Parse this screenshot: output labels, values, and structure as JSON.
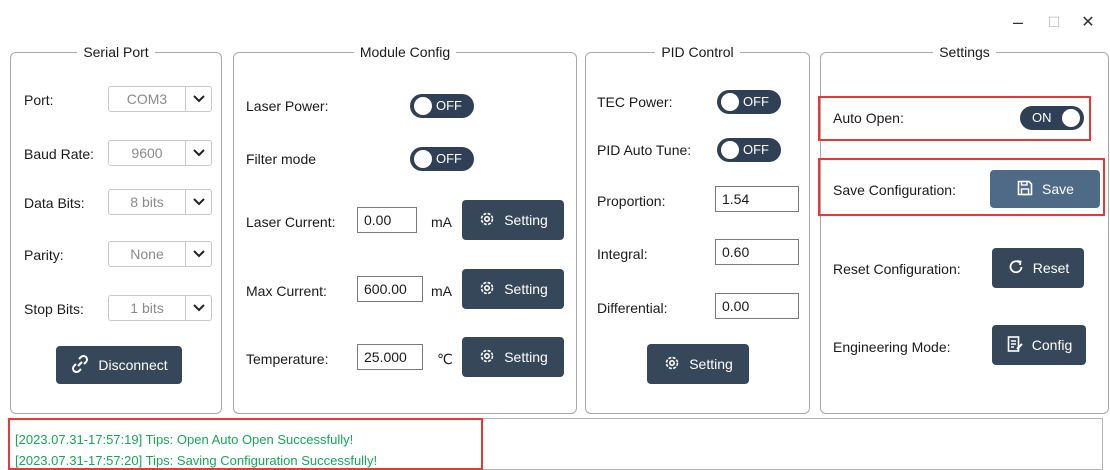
{
  "window": {
    "minimize_glyph": "–",
    "maximize_glyph": "☐",
    "close_glyph": "✕"
  },
  "serial_port": {
    "title": "Serial Port",
    "port_label": "Port:",
    "port_value": "COM3",
    "baud_label": "Baud Rate:",
    "baud_value": "9600",
    "databits_label": "Data Bits:",
    "databits_value": "8 bits",
    "parity_label": "Parity:",
    "parity_value": "None",
    "stopbits_label": "Stop Bits:",
    "stopbits_value": "1 bits",
    "disconnect_label": "Disconnect"
  },
  "module_config": {
    "title": "Module Config",
    "laser_power_label": "Laser Power:",
    "laser_power_state": "OFF",
    "filter_mode_label": "Filter mode",
    "filter_mode_state": "OFF",
    "laser_current_label": "Laser Current:",
    "laser_current_value": "0.00",
    "laser_current_unit": "mA",
    "max_current_label": "Max Current:",
    "max_current_value": "600.00",
    "max_current_unit": "mA",
    "temperature_label": "Temperature:",
    "temperature_value": "25.000",
    "temperature_unit": "℃",
    "setting_label": "Setting"
  },
  "pid_control": {
    "title": "PID Control",
    "tec_power_label": "TEC Power:",
    "tec_power_state": "OFF",
    "pid_autotune_label": "PID Auto Tune:",
    "pid_autotune_state": "OFF",
    "proportion_label": "Proportion:",
    "proportion_value": "1.54",
    "integral_label": "Integral:",
    "integral_value": "0.60",
    "differential_label": "Differential:",
    "differential_value": "0.00",
    "setting_label": "Setting"
  },
  "settings": {
    "title": "Settings",
    "auto_open_label": "Auto Open:",
    "auto_open_state": "ON",
    "save_config_label": "Save Configuration:",
    "save_button": "Save",
    "reset_config_label": "Reset Configuration:",
    "reset_button": "Reset",
    "engineering_label": "Engineering Mode:",
    "config_button": "Config"
  },
  "log": {
    "lines": [
      "[2023.07.31-17:57:19] Tips: Open Auto Open Successfully!",
      "[2023.07.31-17:57:20] Tips: Saving Configuration Successfully!"
    ]
  },
  "colors": {
    "button_dark": "#354759",
    "button_save": "#4e6a87",
    "toggle": "#2f3f55",
    "highlight": "#e53935",
    "log_text": "#1aa35a"
  }
}
